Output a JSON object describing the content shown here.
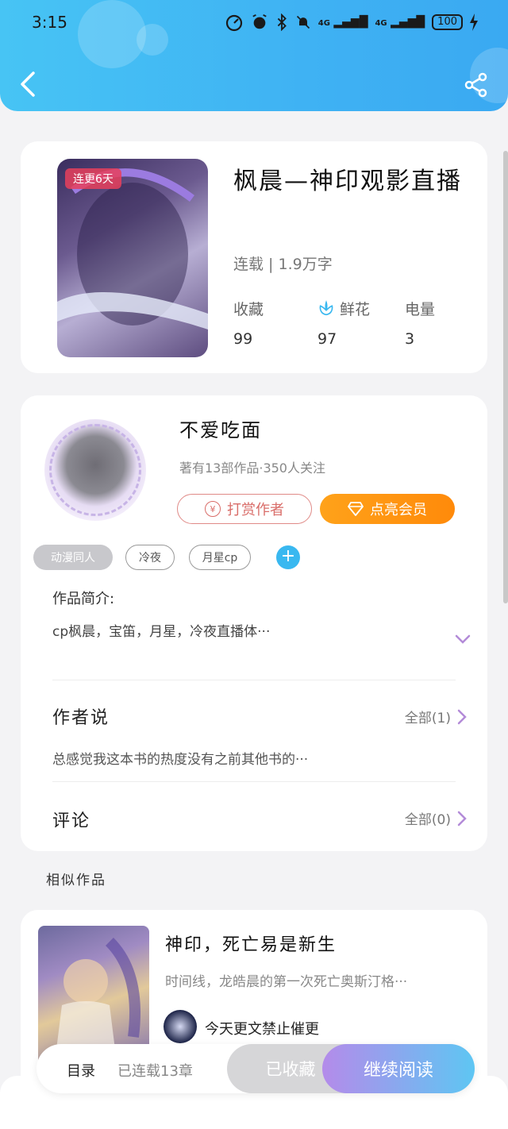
{
  "status_bar": {
    "time": "3:15",
    "network1": "4G",
    "network2": "4G",
    "battery": "100"
  },
  "book": {
    "badge": "连更6天",
    "title": "枫晨—神印观影直播",
    "meta": "连载 | 1.9万字",
    "stats": [
      {
        "label": "收藏",
        "value": "99"
      },
      {
        "label": "鲜花",
        "value": "97"
      },
      {
        "label": "电量",
        "value": "3"
      }
    ]
  },
  "author": {
    "name": "不爱吃面",
    "meta": "著有13部作品·350人关注",
    "reward_label": "打赏作者",
    "reward_icon_text": "¥",
    "vip_label": "点亮会员"
  },
  "tags": [
    "动漫同人",
    "冷夜",
    "月星cp"
  ],
  "intro": {
    "label": "作品简介:",
    "text": "cp枫晨，宝笛，月星，冷夜直播体···"
  },
  "author_notes": {
    "title": "作者说",
    "all_label": "全部(1)",
    "text": "总感觉我这本书的热度没有之前其他书的···"
  },
  "comments": {
    "title": "评论",
    "all_label": "全部(0)"
  },
  "similar": {
    "heading": "相似作品",
    "item": {
      "title": "神印，死亡易是新生",
      "desc": "时间线，龙皓晨的第一次死亡奥斯汀格···",
      "note": "今天更文禁止催更"
    }
  },
  "bottom_bar": {
    "toc_label": "目录",
    "chapters": "已连载13章",
    "fav_label": "已收藏",
    "read_label": "继续阅读"
  },
  "colors": {
    "header": "#3fb2f3",
    "accent_orange": "#ff8a0a",
    "accent_blue": "#39b8f0"
  }
}
